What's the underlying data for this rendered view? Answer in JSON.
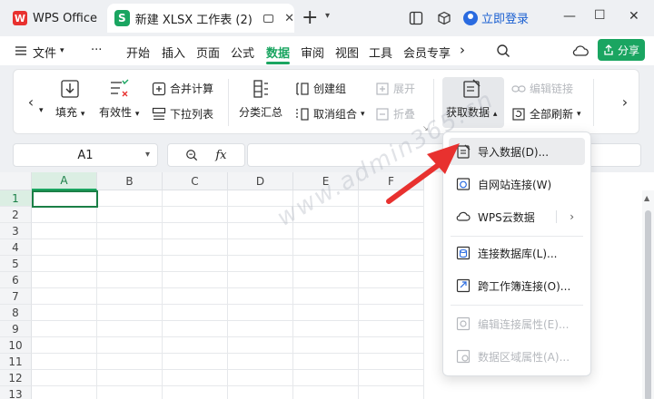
{
  "titlebar": {
    "app_tab_label": "WPS Office",
    "app_logo_letter": "W",
    "doc_icon_letter": "S",
    "doc_tab_label": "新建 XLSX 工作表 (2)",
    "close_glyph": "✕",
    "new_tab_glyph": "+",
    "login_label": "立即登录"
  },
  "menubar": {
    "file_label": "文件",
    "more_label": "···",
    "items": [
      "开始",
      "插入",
      "页面",
      "公式",
      "数据",
      "审阅",
      "视图",
      "工具",
      "会员专享"
    ],
    "active_item": "数据",
    "share_label": "分享"
  },
  "ribbon": {
    "fill_label": "填充",
    "validity_label": "有效性",
    "merge_calc_label": "合并计算",
    "dropdown_list_label": "下拉列表",
    "subtotal_label": "分类汇总",
    "create_group_label": "创建组",
    "ungroup_label": "取消组合",
    "expand_label": "展开",
    "collapse_label": "折叠",
    "get_data_label": "获取数据",
    "edit_links_label": "编辑链接",
    "refresh_all_label": "全部刷新"
  },
  "formula_bar": {
    "name_box_value": "A1",
    "fx_label": "fx",
    "formula_value": ""
  },
  "grid": {
    "columns": [
      "A",
      "B",
      "C",
      "D",
      "E",
      "F"
    ],
    "rows": [
      "1",
      "2",
      "3",
      "4",
      "5",
      "6",
      "7",
      "8",
      "9",
      "10",
      "11",
      "12",
      "13"
    ],
    "active_column": "A",
    "active_row": "1"
  },
  "dropdown": {
    "items": [
      {
        "label": "导入数据(D)...",
        "icon": "import-data-icon",
        "enabled": true,
        "highlighted": true
      },
      {
        "label": "自网站连接(W)",
        "icon": "web-connect-icon",
        "enabled": true
      },
      {
        "label": "WPS云数据",
        "icon": "cloud-icon",
        "enabled": true,
        "submenu": true
      },
      {
        "label": "连接数据库(L)...",
        "icon": "database-icon",
        "enabled": true
      },
      {
        "label": "跨工作簿连接(O)...",
        "icon": "workbook-link-icon",
        "enabled": true
      },
      {
        "label": "编辑连接属性(E)...",
        "icon": "edit-connection-icon",
        "enabled": false
      },
      {
        "label": "数据区域属性(A)...",
        "icon": "range-properties-icon",
        "enabled": false
      }
    ]
  },
  "watermark": "www.admin365.cn",
  "colors": {
    "accent": "#1aa561",
    "active_cell_border": "#1a7f46",
    "login_blue": "#1a5fd1",
    "arrow_red": "#e8312f",
    "disabled_text": "#b5b8bd"
  }
}
